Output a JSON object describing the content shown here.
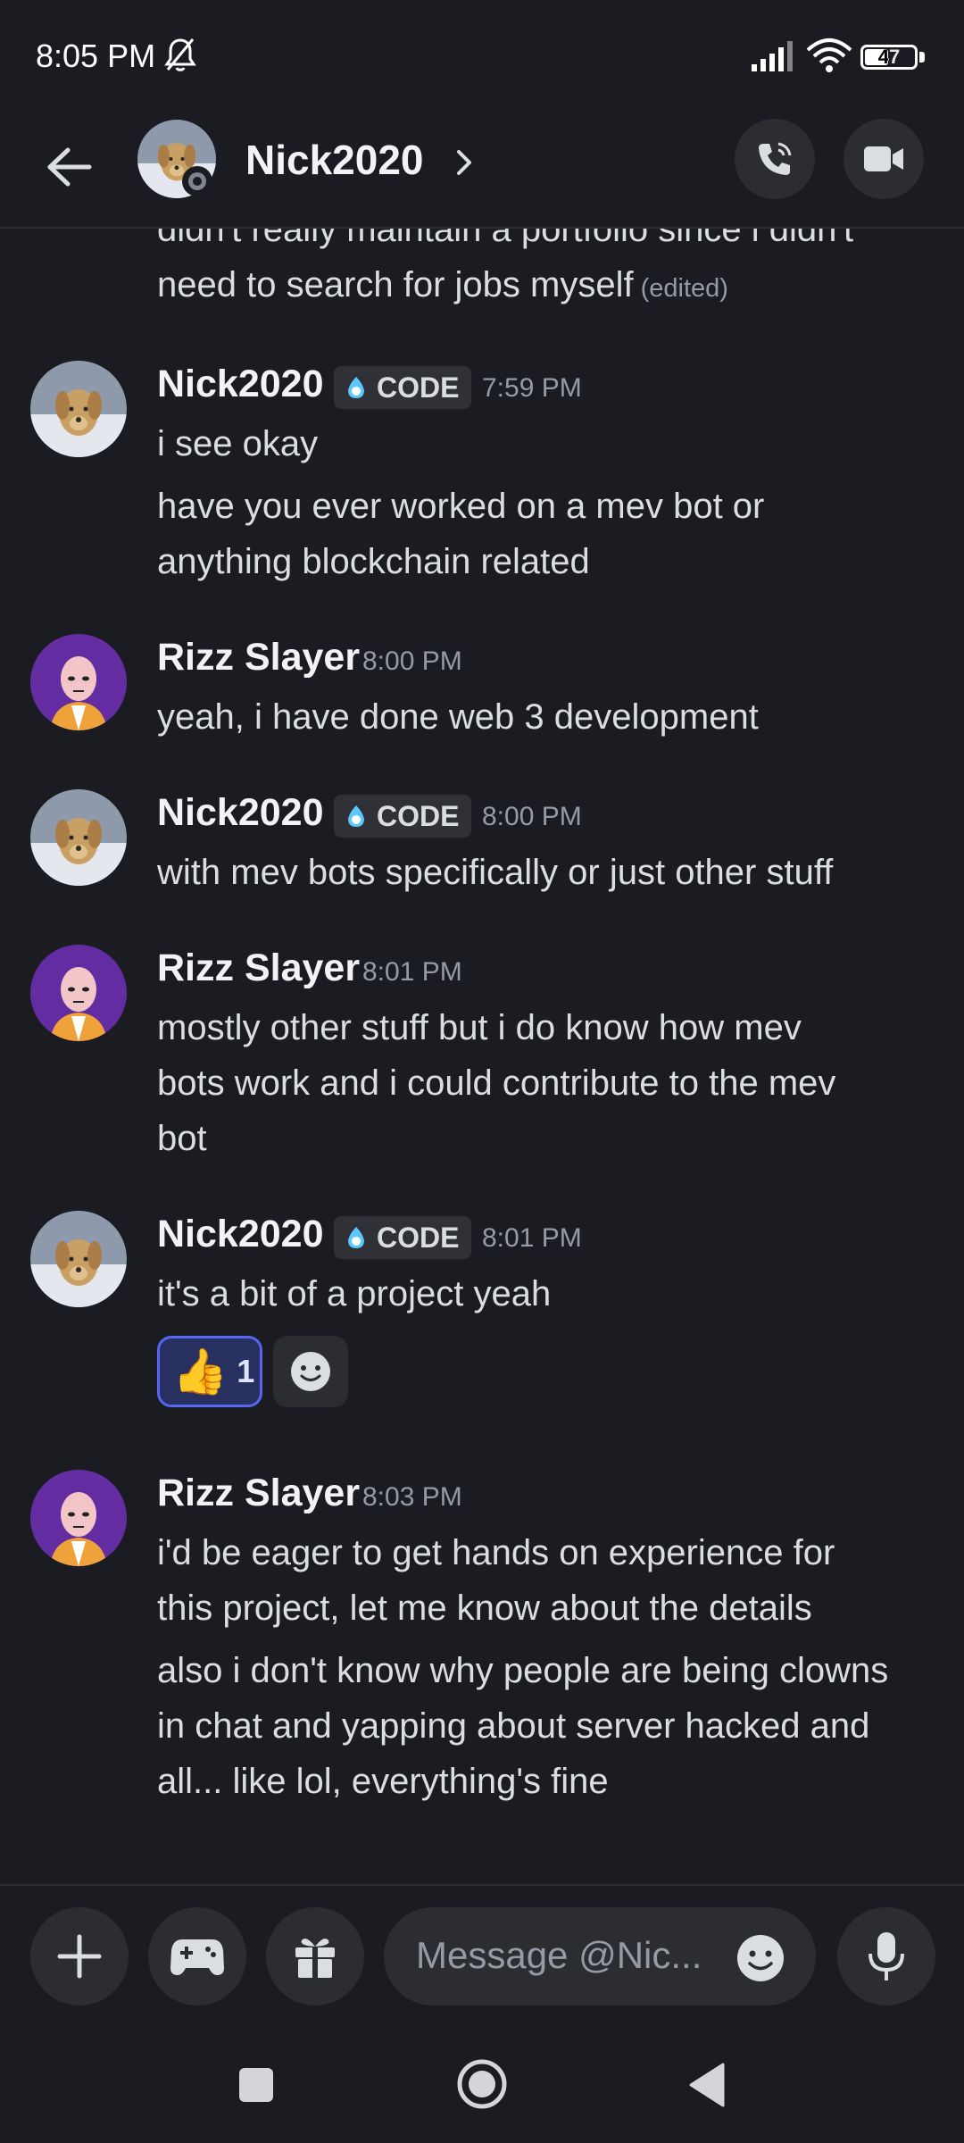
{
  "status_bar": {
    "time": "8:05 PM",
    "battery": "47"
  },
  "header": {
    "contact_name": "Nick2020"
  },
  "clan_tag": "CODE",
  "messages": {
    "prev_line1": "didn't really maintain a portfolio since i didn't",
    "prev_line2": "need to search for jobs myself",
    "prev_edited": "(edited)",
    "m1": {
      "author": "Nick2020",
      "time": "7:59 PM",
      "text1": "i see okay",
      "text2_line1": "have you ever worked on a mev bot or",
      "text2_line2": "anything blockchain related"
    },
    "m2": {
      "author": "Rizz Slayer",
      "time": "8:00 PM",
      "text": "yeah, i have done web 3 development"
    },
    "m3": {
      "author": "Nick2020",
      "time": "8:00 PM",
      "text": "with mev bots specifically or just other stuff"
    },
    "m4": {
      "author": "Rizz Slayer",
      "time": "8:01 PM",
      "line1": "mostly other stuff but i do know how mev",
      "line2": "bots work and i could contribute to the mev",
      "line3": "bot"
    },
    "m5": {
      "author": "Nick2020",
      "time": "8:01 PM",
      "text": "it's a bit of a project yeah",
      "reaction_emoji": "👍",
      "reaction_count": "1"
    },
    "m6": {
      "author": "Rizz Slayer",
      "time": "8:03 PM",
      "a_line1": "i'd be eager to get hands on experience for",
      "a_line2": "this project, let me know about the details",
      "b_line1": "also i don't know why people are being clowns",
      "b_line2": "in chat and yapping about server hacked and",
      "b_line3": "all... like lol, everything's fine"
    }
  },
  "composer": {
    "placeholder": "Message @Nic..."
  },
  "colors": {
    "background": "#1b1c21",
    "surface": "#2b2d31",
    "accent": "#5865f2",
    "muted": "#949ba4"
  },
  "icons": [
    "bell-off-icon",
    "signal-icon",
    "wifi-icon",
    "battery-icon",
    "back-arrow-icon",
    "chevron-right-icon",
    "phone-icon",
    "video-icon",
    "plus-icon",
    "gamepad-icon",
    "gift-icon",
    "emoji-icon",
    "mic-icon",
    "nav-square-icon",
    "nav-home-icon",
    "nav-back-icon"
  ]
}
